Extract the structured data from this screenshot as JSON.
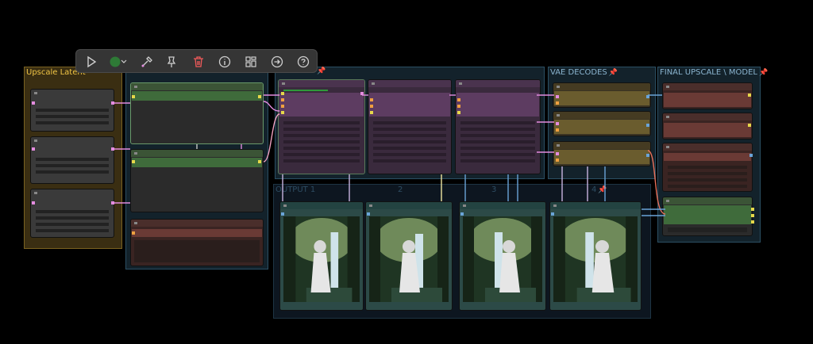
{
  "groups": {
    "upscale_latent": {
      "title": "Upscale Latent"
    },
    "vae_decodes": {
      "title": "VAE DECODES"
    },
    "final_upscale": {
      "title": "FINAL UPSCALE \\ MODEL"
    },
    "output": {
      "title": "OUTPUT 1",
      "col2": "2",
      "col3": "3",
      "col4": "4"
    }
  },
  "toolbar": {
    "items": [
      "play-icon",
      "color-dot-icon",
      "chevron-down-icon",
      "eyedropper-icon",
      "pin-icon",
      "trash-icon",
      "info-icon",
      "layout-icon",
      "arrow-right-icon",
      "help-icon"
    ]
  },
  "colors": {
    "group_yellow": "#c8a238",
    "group_teal": "#2b5f79",
    "node_green": "#3f6b3b",
    "node_purple": "#5d3c61",
    "node_olive": "#6a5c2e",
    "node_red": "#6a3a35",
    "node_teal": "#345b58"
  }
}
